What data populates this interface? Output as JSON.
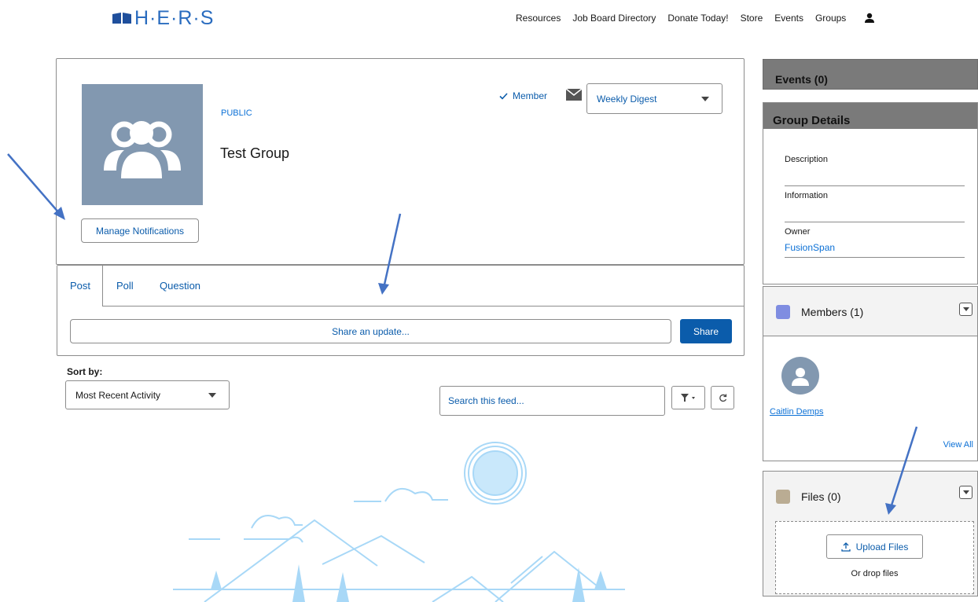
{
  "header": {
    "logo_text": "H·E·R·S",
    "nav": [
      "Resources",
      "Job Board Directory",
      "Donate Today!",
      "Store",
      "Events",
      "Groups"
    ]
  },
  "group": {
    "visibility": "PUBLIC",
    "name": "Test Group",
    "member_status": "Member",
    "digest_option": "Weekly Digest",
    "manage_notifications": "Manage Notifications"
  },
  "publisher": {
    "tabs": [
      "Post",
      "Poll",
      "Question"
    ],
    "active_tab": "Post",
    "placeholder": "Share an update...",
    "share_label": "Share"
  },
  "feed": {
    "sort_label": "Sort by:",
    "sort_value": "Most Recent Activity",
    "search_placeholder": "Search this feed..."
  },
  "sidebar": {
    "events_title": "Events (0)",
    "details_title": "Group Details",
    "fields": {
      "description_label": "Description",
      "information_label": "Information",
      "owner_label": "Owner",
      "owner_value": "FusionSpan"
    },
    "members_title": "Members (1)",
    "members": [
      "Caitlin Demps"
    ],
    "view_all": "View All",
    "files_title": "Files (0)",
    "upload_label": "Upload Files",
    "drop_label": "Or drop files"
  },
  "colors": {
    "accent": "#0b5cab",
    "link": "#0b70d6",
    "avatar": "#8298b0",
    "panel_header": "#7a7a7a",
    "annotation_arrow": "#4472c4"
  }
}
